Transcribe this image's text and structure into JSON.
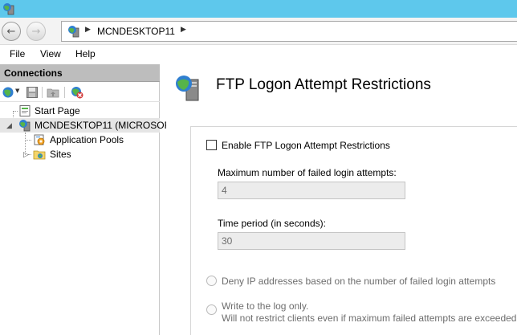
{
  "address": {
    "server": "MCNDESKTOP11"
  },
  "menu": {
    "file": "File",
    "view": "View",
    "help": "Help"
  },
  "connections": {
    "header": "Connections",
    "tree": {
      "start_page": "Start Page",
      "server": "MCNDESKTOP11 (MICROSOF",
      "app_pools": "Application Pools",
      "sites": "Sites"
    }
  },
  "page": {
    "title": "FTP Logon Attempt Restrictions",
    "enable_label": "Enable FTP Logon Attempt Restrictions",
    "enable_checked": false,
    "max_attempts_label": "Maximum number of failed login attempts:",
    "max_attempts_value": "4",
    "time_period_label": "Time period (in seconds):",
    "time_period_value": "30",
    "option_deny": "Deny IP addresses based on the number of failed login attempts",
    "option_log": "Write to the log only.",
    "option_log_note": "Will not restrict clients even if maximum failed attempts are exceeded."
  },
  "colors": {
    "titlebar": "#5ec8ec",
    "header_gray": "#bdbdbd"
  }
}
